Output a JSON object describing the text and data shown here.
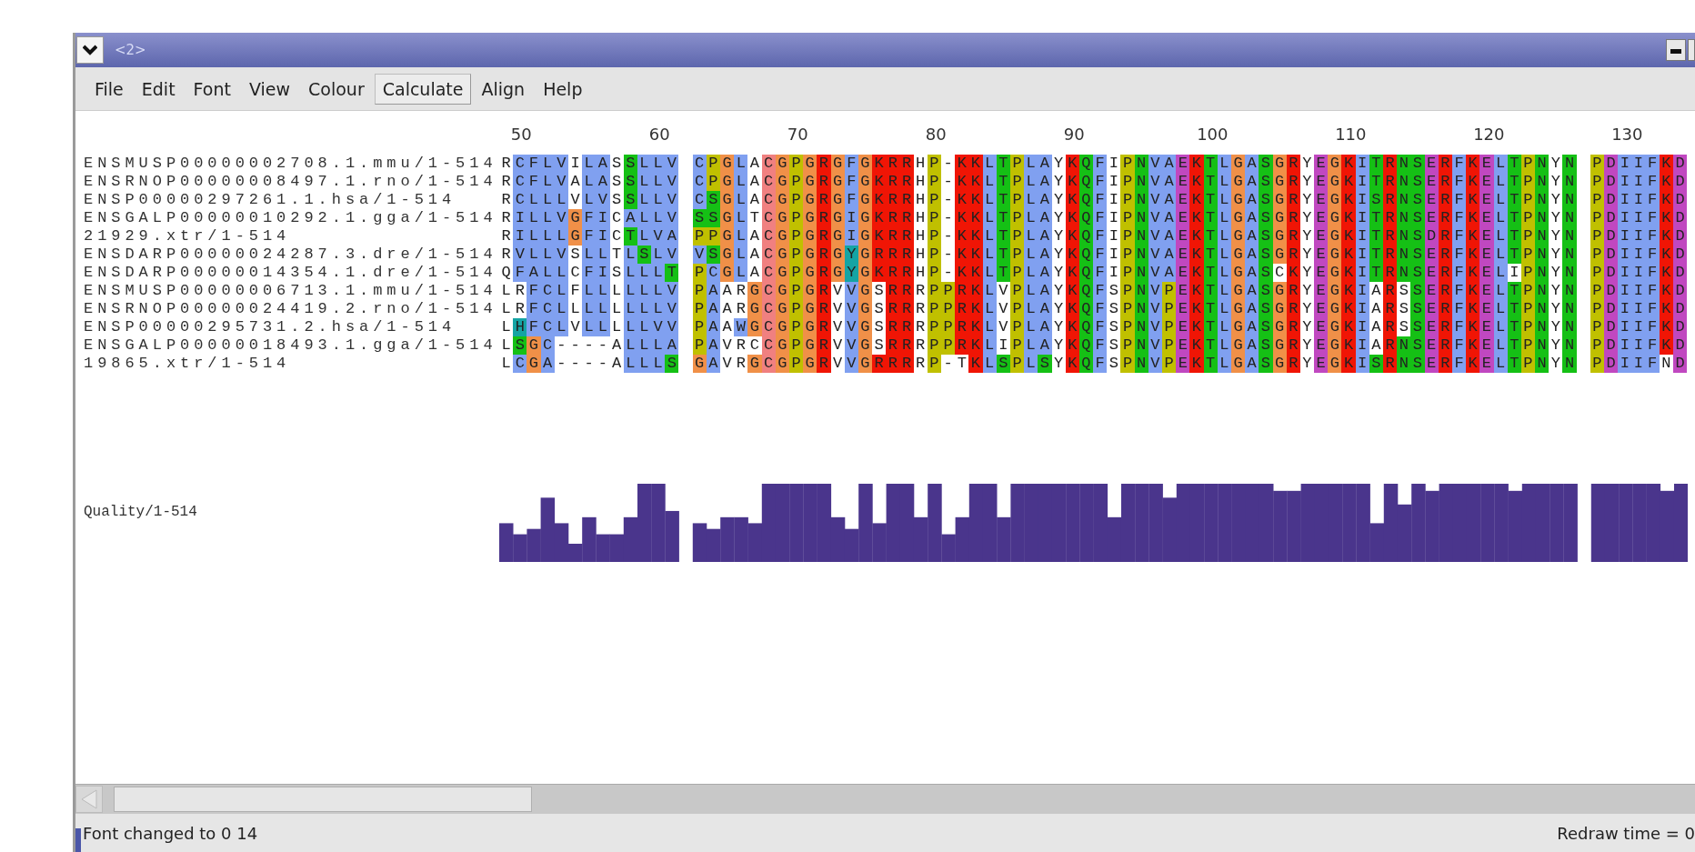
{
  "window": {
    "title": "<2>"
  },
  "menu": [
    {
      "label": "File",
      "selected": false
    },
    {
      "label": "Edit",
      "selected": false
    },
    {
      "label": "Font",
      "selected": false
    },
    {
      "label": "View",
      "selected": false
    },
    {
      "label": "Colour",
      "selected": false
    },
    {
      "label": "Calculate",
      "selected": true
    },
    {
      "label": "Align",
      "selected": false
    },
    {
      "label": "Help",
      "selected": false
    }
  ],
  "alignment": {
    "ruler": [
      "50",
      "60",
      "70",
      "80",
      "90",
      "100",
      "110",
      "120",
      "130"
    ],
    "sequences": [
      {
        "name": "ENSMUSP00000002708.1.mmu/1-514",
        "residues": "RCFLVILASSLLV CPGLACGPGRGFGKRRHP-KKLTPLAYKQFIPNVAEKTLGASGRYEGKITRNSERFKELTPNYN PDIIFKD"
      },
      {
        "name": "ENSRNOP00000008497.1.rno/1-514",
        "residues": "RCFLVALASSLLV CPGLACGPGRGFGKRRHP-KKLTPLAYKQFIPNVAEKTLGASGRYEGKITRNSERFKELTPNYN PDIIFKD"
      },
      {
        "name": "ENSP00000297261.1.hsa/1-514",
        "residues": "RCLLLVLVSSLLV CSGLACGPGRGFGKRRHP-KKLTPLAYKQFIPNVAEKTLGASGRYEGKISRNSERFKELTPNYN PDIIFKD"
      },
      {
        "name": "ENSGALP00000010292.1.gga/1-514",
        "residues": "RILLVGFICALLV SSGLTCGPGRGIGKRRHP-KKLTPLAYKQFIPNVAEKTLGASGRYEGKITRNSERFKELTPNYN PDIIFKD"
      },
      {
        "name": "21929.xtr/1-514",
        "residues": "RILLLGFICTLVA PPGLACGPGRGIGKRRHP-KKLTPLAYKQFIPNVAEKTLGASGRYEGKITRNSDRFKELTPNYN PDIIFKD"
      },
      {
        "name": "ENSDARP00000024287.3.dre/1-514",
        "residues": "RVLLVSLLTLSLV VSGLACGPGRGYGRRRHP-KKLTPLAYKQFIPNVAEKTLGASGRYEGKITRNSERFKELTPNYN PDIIFKD"
      },
      {
        "name": "ENSDARP00000014354.1.dre/1-514",
        "residues": "QFALLCFISLLLT PCGLACGPGRGYGKRRHP-KKLTPLAYKQFIPNVAEKTLGASCKYEGKITRNSERFKELIPNYN PDIIFKD"
      },
      {
        "name": "ENSMUSP00000006713.1.mmu/1-514",
        "residues": "LRFCLFLLLLLLV PAARGCGPGRVVGSRRRPPRKLVPLAYKQFSPNVPEKTLGASGRYEGKIARSSERFKELTPNYN PDIIFKD"
      },
      {
        "name": "ENSRNOP00000024419.2.rno/1-514",
        "residues": "LRFCLLLLLLLLV PAARGCGPGRVVGSRRRPPRKLVPLAYKQFSPNVPEKTLGASGRYEGKIARSSERFKELTPNYN PDIIFKD"
      },
      {
        "name": "ENSP00000295731.2.hsa/1-514",
        "residues": "LHFCLVLLLLLVV PAAWGCGPGRVVGSRRRPPRKLVPLAYKQFSPNVPEKTLGASGRYEGKIARSSERFKELTPNYN PDIIFKD"
      },
      {
        "name": "ENSGALP00000018493.1.gga/1-514",
        "residues": "LSGC----ALLLA PAVRCCGPGRVVGSRRRPPRKLIPLAYKQFSPNVPEKTLGASGRYEGKIARNSERFKELTPNYN PDIIFKD"
      },
      {
        "name": "19865.xtr/1-514",
        "residues": "LCGA----ALLLS GAVRGCGPGRVVGRRRRP-TKLSPLSYKQFSPNVPEKTLGASGRYEGKISRNSERFKELTPNYN PDIIFND"
      }
    ]
  },
  "annotations": [
    {
      "label": "Quality/1-514",
      "kind": "quality"
    }
  ],
  "status_bar": {
    "message": "Font changed to 0 14",
    "redraw": "Redraw time = 0"
  }
}
